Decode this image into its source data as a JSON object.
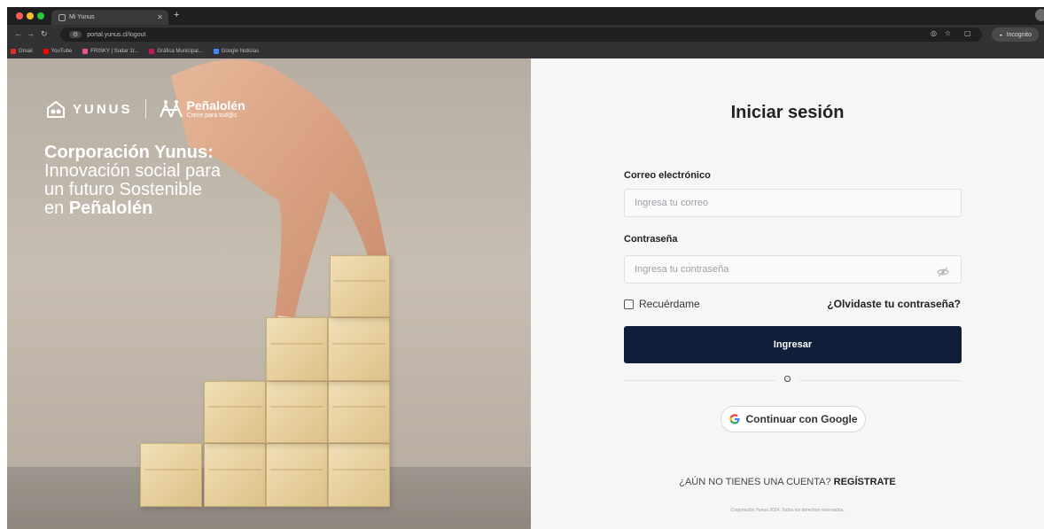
{
  "browser": {
    "tab_title": "Mi Yunus",
    "url": "portal.yunus.cl/logout",
    "profile_label": "Incognito",
    "bookmarks": [
      {
        "label": "Gmail",
        "color": "#d93025"
      },
      {
        "label": "YouTube",
        "color": "#ff0000"
      },
      {
        "label": "FRISKY | Sudar 1t...",
        "color": "#e9538f"
      },
      {
        "label": "Gráfica Municipal...",
        "color": "#c2185b"
      },
      {
        "label": "Google Noticias",
        "color": "#4285f4"
      }
    ]
  },
  "hero": {
    "logo_yunus": "YUNUS",
    "logo_penalolen": "Peñalolén",
    "logo_penalolen_tag": "Crece para tod@s",
    "title_strong": "Corporación Yunus:",
    "title_line2": "Innovación social para",
    "title_line3": "un futuro Sostenible",
    "title_line4_prefix": "en ",
    "title_line4_bold": "Peñalolén"
  },
  "login": {
    "title": "Iniciar sesión",
    "email_label": "Correo electrónico",
    "email_placeholder": "Ingresa tu correo",
    "email_value": "",
    "password_label": "Contraseña",
    "password_placeholder": "Ingresa tu contraseña",
    "password_value": "",
    "remember_label": "Recuérdame",
    "forgot_label": "¿Olvidaste tu contraseña?",
    "submit_label": "Ingresar",
    "divider_label": "O",
    "google_label": "Continuar con Google",
    "signup_prompt": "¿AÚN NO TIENES UNA CUENTA? ",
    "signup_link": "REGÍSTRATE",
    "footer": "Corporación Yunus 2024. Todos los derechos reservados."
  },
  "colors": {
    "primary_button": "#0f1f3a",
    "panel_background": "#f6f6f7"
  }
}
